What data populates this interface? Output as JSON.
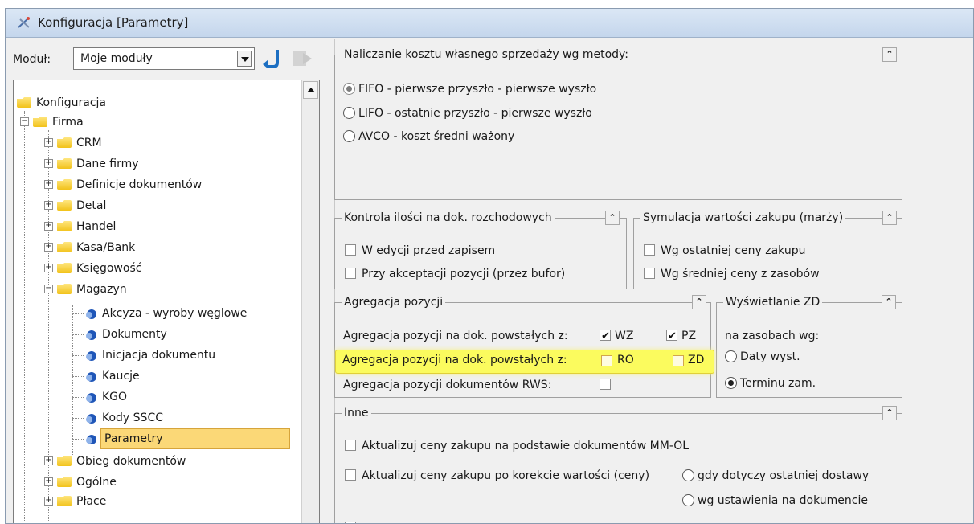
{
  "window": {
    "title": "Konfiguracja [Parametry]"
  },
  "module": {
    "label": "Moduł:",
    "value": "Moje moduły"
  },
  "tree": {
    "root": "Konfiguracja",
    "firma": "Firma",
    "items": [
      "CRM",
      "Dane firmy",
      "Definicje dokumentów",
      "Detal",
      "Handel",
      "Kasa/Bank",
      "Księgowość",
      "Magazyn"
    ],
    "magazyn_children": [
      "Akcyza - wyroby węglowe",
      "Dokumenty",
      "Inicjacja dokumentu",
      "Kaucje",
      "KGO",
      "Kody SSCC",
      "Parametry"
    ],
    "after": [
      "Obieg dokumentów",
      "Ogólne",
      "Płace"
    ]
  },
  "cost_method": {
    "title": "Naliczanie kosztu własnego sprzedaży wg metody:",
    "options": [
      "FIFO - pierwsze przyszło - pierwsze wyszło",
      "LIFO - ostatnie przyszło - pierwsze wyszło",
      "AVCO - koszt średni ważony"
    ],
    "selected": "FIFO - pierwsze przyszło - pierwsze wyszło"
  },
  "quantity_control": {
    "title": "Kontrola ilości na dok. rozchodowych",
    "options": [
      "W edycji przed zapisem",
      "Przy akceptacji pozycji (przez bufor)"
    ]
  },
  "simulation": {
    "title": "Symulacja wartości zakupu (marży)",
    "options": [
      "Wg ostatniej ceny zakupu",
      "Wg średniej ceny z zasobów"
    ]
  },
  "aggregation": {
    "title": "Agregacja pozycji",
    "row1_label": "Agregacja pozycji na dok. powstałych z:",
    "row1_a": "WZ",
    "row1_b": "PZ",
    "row2_label": "Agregacja pozycji na dok. powstałych z:",
    "row2_a": "RO",
    "row2_b": "ZD",
    "row3_label": "Agregacja pozycji dokumentów RWS:"
  },
  "zd_display": {
    "title": "Wyświetlanie ZD",
    "subtitle": "na zasobach wg:",
    "options": [
      "Daty wyst.",
      "Terminu zam."
    ],
    "selected": "Terminu zam."
  },
  "other": {
    "title": "Inne",
    "opt1": "Aktualizuj ceny zakupu na podstawie dokumentów MM-OL",
    "opt2": "Aktualizuj ceny zakupu po korekcie wartości (ceny)",
    "opt2_a": "gdy dotyczy ostatniej dostawy",
    "opt2_b": "wg ustawienia na dokumencie"
  },
  "colors": {
    "highlight": "#fbfb5e",
    "selection": "#fbd877",
    "titlebar": "#c4d6ec"
  }
}
